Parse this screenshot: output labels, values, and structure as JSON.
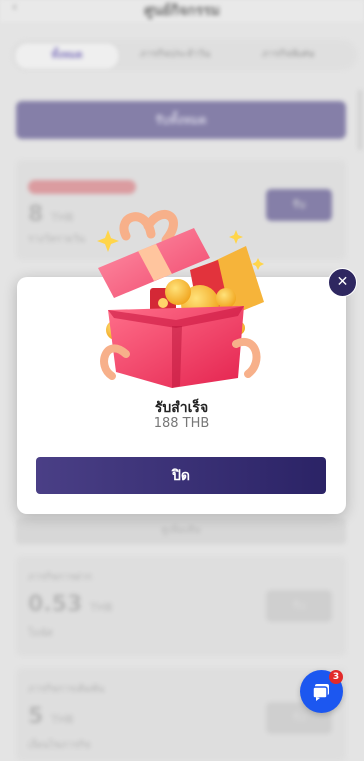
{
  "background": {
    "header": {
      "back_glyph": "‹",
      "title": "ศูนย์กิจกรรม"
    },
    "tabs": [
      "ทั้งหมด",
      "ภารกิจประจำวัน",
      "ภารกิจพิเศษ"
    ],
    "primary_button": "รับทั้งหมด",
    "card1": {
      "amount": "8",
      "unit": "THB",
      "sub": "รางวัลรายวัน",
      "button": "รับ"
    },
    "strip_label": "ดูเพิ่มเติม",
    "card2": {
      "label": "ภารกิจการฝาก",
      "amount": "0.53",
      "unit": "THB",
      "sub": "โบนัส",
      "button": "รับ"
    },
    "card3": {
      "label": "ภารกิจการเดิมพัน",
      "amount": "5",
      "unit": "THB",
      "sub": "เงื่อนไขภารกิจ",
      "button": "รับ"
    }
  },
  "modal": {
    "title": "รับสำเร็จ",
    "amount": "188 THB",
    "close_button": "ปิด",
    "close_icon": "✕"
  },
  "chat": {
    "badge_count": "3"
  },
  "colors": {
    "accent": "#2e2760",
    "button_start": "#4a3f86",
    "button_end": "#2b2366",
    "chat": "#1c57f0",
    "badge": "#e22a2a"
  }
}
